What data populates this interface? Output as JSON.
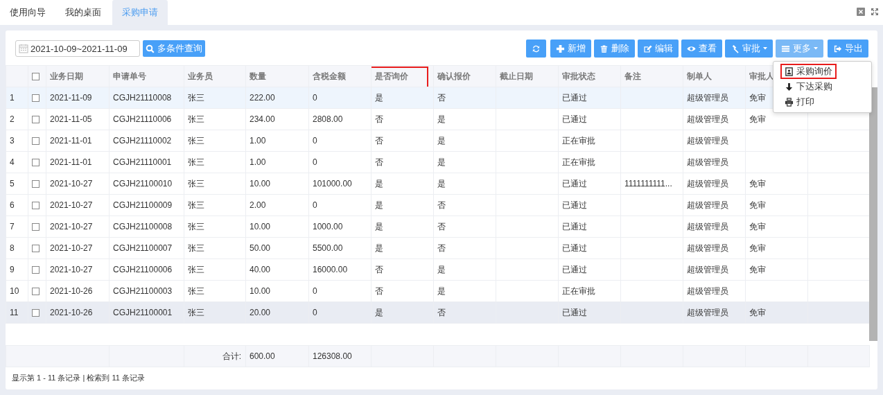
{
  "tabs": [
    {
      "label": "使用向导",
      "selected": false
    },
    {
      "label": "我的桌面",
      "selected": false
    },
    {
      "label": "采购申请",
      "selected": true
    }
  ],
  "filter": {
    "date_range": "2021-10-09~2021-11-09",
    "search_button": "多条件查询"
  },
  "toolbar": [
    {
      "caret": false,
      "open": false
    },
    {
      "label": "新增",
      "caret": false,
      "open": false
    },
    {
      "label": "删除",
      "caret": false,
      "open": false
    },
    {
      "label": "编辑",
      "caret": false,
      "open": false
    },
    {
      "label": "查看",
      "caret": false,
      "open": false
    },
    {
      "label": "审批",
      "caret": true,
      "open": false
    },
    {
      "label": "更多",
      "caret": true,
      "open": true
    },
    {
      "label": "导出",
      "caret": false,
      "open": false
    }
  ],
  "menu": [
    {
      "label": "采购询价",
      "highlighted": true
    },
    {
      "label": "下达采购",
      "highlighted": false
    },
    {
      "label": "打印",
      "highlighted": false
    }
  ],
  "table": {
    "select_all_checked": false,
    "columns": [
      {
        "label": "业务日期",
        "highlighted": false
      },
      {
        "label": "申请单号",
        "highlighted": false
      },
      {
        "label": "业务员",
        "highlighted": false
      },
      {
        "label": "数量",
        "highlighted": false
      },
      {
        "label": "含税金额",
        "highlighted": false
      },
      {
        "label": "是否询价",
        "highlighted": true
      },
      {
        "label": "确认报价",
        "highlighted": false
      },
      {
        "label": "截止日期",
        "highlighted": false
      },
      {
        "label": "审批状态",
        "highlighted": false
      },
      {
        "label": "备注",
        "highlighted": false
      },
      {
        "label": "制单人",
        "highlighted": false
      },
      {
        "label": "审批人",
        "highlighted": false
      }
    ],
    "rows": [
      {
        "index": "1",
        "checked": false,
        "selected": true,
        "hovered": false,
        "cells": [
          "2021-11-09",
          "CGJH21110008",
          "张三",
          "222.00",
          "0",
          "是",
          "否",
          "",
          "已通过",
          "",
          "超级管理员",
          "免审"
        ]
      },
      {
        "index": "2",
        "checked": false,
        "selected": false,
        "hovered": false,
        "cells": [
          "2021-11-05",
          "CGJH21110006",
          "张三",
          "234.00",
          "2808.00",
          "否",
          "是",
          "",
          "已通过",
          "",
          "超级管理员",
          "免审"
        ]
      },
      {
        "index": "3",
        "checked": false,
        "selected": false,
        "hovered": false,
        "cells": [
          "2021-11-01",
          "CGJH21110002",
          "张三",
          "1.00",
          "0",
          "否",
          "是",
          "",
          "正在审批",
          "",
          "超级管理员",
          ""
        ]
      },
      {
        "index": "4",
        "checked": false,
        "selected": false,
        "hovered": false,
        "cells": [
          "2021-11-01",
          "CGJH21110001",
          "张三",
          "1.00",
          "0",
          "否",
          "是",
          "",
          "正在审批",
          "",
          "超级管理员",
          ""
        ]
      },
      {
        "index": "5",
        "checked": false,
        "selected": false,
        "hovered": false,
        "cells": [
          "2021-10-27",
          "CGJH21100010",
          "张三",
          "10.00",
          "101000.00",
          "是",
          "是",
          "",
          "已通过",
          "1111111111...",
          "超级管理员",
          "免审"
        ]
      },
      {
        "index": "6",
        "checked": false,
        "selected": false,
        "hovered": false,
        "cells": [
          "2021-10-27",
          "CGJH21100009",
          "张三",
          "2.00",
          "0",
          "是",
          "否",
          "",
          "已通过",
          "",
          "超级管理员",
          "免审"
        ]
      },
      {
        "index": "7",
        "checked": false,
        "selected": false,
        "hovered": false,
        "cells": [
          "2021-10-27",
          "CGJH21100008",
          "张三",
          "10.00",
          "1000.00",
          "是",
          "否",
          "",
          "已通过",
          "",
          "超级管理员",
          "免审"
        ]
      },
      {
        "index": "8",
        "checked": false,
        "selected": false,
        "hovered": false,
        "cells": [
          "2021-10-27",
          "CGJH21100007",
          "张三",
          "50.00",
          "5500.00",
          "是",
          "否",
          "",
          "已通过",
          "",
          "超级管理员",
          "免审"
        ]
      },
      {
        "index": "9",
        "checked": false,
        "selected": false,
        "hovered": false,
        "cells": [
          "2021-10-27",
          "CGJH21100006",
          "张三",
          "40.00",
          "16000.00",
          "否",
          "是",
          "",
          "已通过",
          "",
          "超级管理员",
          "免审"
        ]
      },
      {
        "index": "10",
        "checked": false,
        "selected": false,
        "hovered": false,
        "cells": [
          "2021-10-26",
          "CGJH21100003",
          "张三",
          "10.00",
          "0",
          "否",
          "是",
          "",
          "正在审批",
          "",
          "超级管理员",
          ""
        ]
      },
      {
        "index": "11",
        "checked": false,
        "selected": false,
        "hovered": true,
        "cells": [
          "2021-10-26",
          "CGJH21100001",
          "张三",
          "20.00",
          "0",
          "是",
          "否",
          "",
          "已通过",
          "",
          "超级管理员",
          "免审"
        ]
      }
    ],
    "totals": {
      "label": "合计:",
      "quantity": "600.00",
      "amount": "126308.00"
    }
  },
  "status_bar": "显示第 1 - 11 条记录 | 检索到 11 条记录"
}
